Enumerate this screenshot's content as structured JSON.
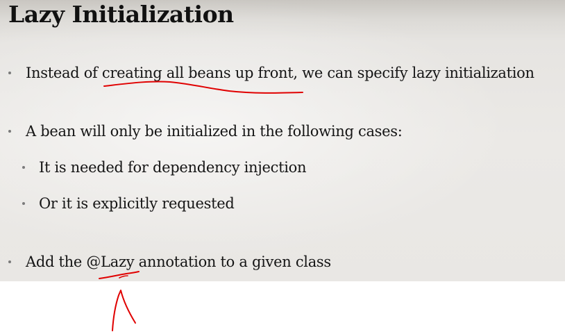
{
  "slide": {
    "title": "Lazy Initialization",
    "bullets": [
      {
        "text": "Instead of creating all beans up front, we can specify lazy initialization",
        "level": 1
      },
      {
        "text": "A bean will only be initialized in the following cases:",
        "level": 1
      },
      {
        "text": "It is needed for dependency injection",
        "level": 2
      },
      {
        "text": "Or it is explicitly requested",
        "level": 2
      },
      {
        "text": "Add the @Lazy annotation to a given class",
        "level": 1
      }
    ]
  },
  "annotations": {
    "ink_color": "#e00000",
    "marks": [
      "underline-creating-all-beans-up-front",
      "underline-at-lazy",
      "arrow-pointing-up"
    ]
  }
}
